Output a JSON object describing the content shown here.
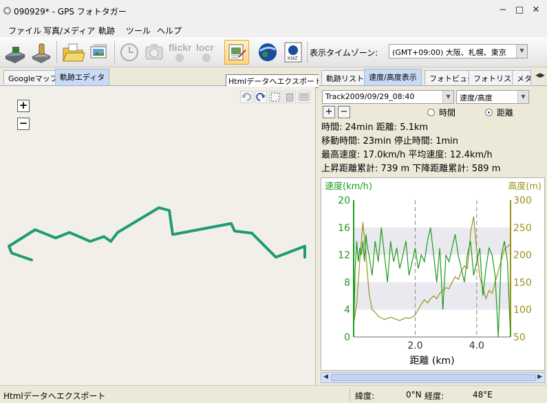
{
  "window": {
    "title": "090929* - GPS フォトタガー",
    "minimize": "−",
    "maximize": "□",
    "close": "✕"
  },
  "menu": [
    "ファイル",
    "写真/メディア",
    "軌跡",
    "ツール",
    "ヘルプ"
  ],
  "toolbar": {
    "flickr_label": "flickr",
    "locr_label": "locr",
    "kmz_label": "KMZ",
    "timezone_label": "表示タイムゾーン:",
    "timezone_value": "(GMT+09:00) 大阪、札幌、東京",
    "tooltip": "Htmlデータへエクスポート"
  },
  "left_tabs": [
    "Googleマップ",
    "軌跡エディタ"
  ],
  "map": {
    "zoom_in": "+",
    "zoom_out": "−"
  },
  "right_tabs": [
    "軌跡リスト",
    "速度/高度表示",
    "フォトビュー",
    "フォトリスト",
    "メタ"
  ],
  "controls": {
    "track": "Track2009/09/29_08:40",
    "mode": "速度/高度",
    "add": "+",
    "remove": "−",
    "radio_time": "時間",
    "radio_distance": "距離",
    "selected": "distance"
  },
  "stats": {
    "line1": "時間: 24min  距離: 5.1km",
    "line2": "移動時間: 23min  停止時間: 1min",
    "line3": "最高速度: 17.0km/h  平均速度: 12.4km/h",
    "line4": "上昇距離累計: 739 m  下降距離累計: 589 m"
  },
  "chart_data": {
    "type": "line",
    "xlabel": "距離 (km)",
    "xlim": [
      0,
      5.1
    ],
    "x_ticks": [
      "2.0",
      "4.0"
    ],
    "y_left": {
      "label": "速度(km/h)",
      "lim": [
        0,
        20
      ],
      "ticks": [
        "0",
        "4",
        "8",
        "12",
        "16",
        "20"
      ],
      "color": "#1a9a1a"
    },
    "y_right": {
      "label": "高度(m)",
      "lim": [
        50,
        300
      ],
      "ticks": [
        "50",
        "100",
        "150",
        "200",
        "250",
        "300"
      ],
      "color": "#9b9018"
    },
    "series": [
      {
        "color": "#1a9a1a",
        "x": [
          0.0,
          0.05,
          0.1,
          0.15,
          0.2,
          0.25,
          0.3,
          0.35,
          0.4,
          0.45,
          0.5,
          0.6,
          0.7,
          0.8,
          0.9,
          1.0,
          1.1,
          1.2,
          1.3,
          1.4,
          1.5,
          1.6,
          1.7,
          1.8,
          1.9,
          2.0,
          2.1,
          2.2,
          2.3,
          2.4,
          2.5,
          2.6,
          2.7,
          2.8,
          2.9,
          3.0,
          3.1,
          3.2,
          3.3,
          3.4,
          3.5,
          3.6,
          3.7,
          3.8,
          3.9,
          4.0,
          4.1,
          4.2,
          4.3,
          4.4,
          4.5,
          4.6,
          4.7,
          4.8,
          4.9,
          5.0,
          5.1
        ],
        "values": [
          0,
          10,
          14,
          11,
          13,
          12,
          14,
          11,
          15,
          13,
          12,
          9,
          14,
          11,
          16,
          12,
          8,
          14,
          11,
          13,
          10,
          12,
          14,
          9,
          11,
          13,
          10,
          12,
          11,
          14,
          16,
          12,
          8,
          13,
          4,
          12,
          11,
          13,
          15,
          12,
          10,
          8,
          12,
          14,
          9,
          11,
          13,
          6,
          10,
          13,
          12,
          9,
          0,
          12,
          14,
          11,
          0
        ]
      },
      {
        "color": "#9b9018",
        "x": [
          0.0,
          0.1,
          0.2,
          0.3,
          0.4,
          0.5,
          0.6,
          0.7,
          0.8,
          0.9,
          1.0,
          1.1,
          1.2,
          1.3,
          1.4,
          1.5,
          1.6,
          1.7,
          1.8,
          1.9,
          2.0,
          2.1,
          2.2,
          2.3,
          2.4,
          2.5,
          2.6,
          2.7,
          2.8,
          2.9,
          3.0,
          3.1,
          3.2,
          3.3,
          3.4,
          3.5,
          3.6,
          3.7,
          3.8,
          3.9,
          4.0,
          4.1,
          4.2,
          4.3,
          4.4,
          4.5,
          4.6,
          4.7,
          4.8,
          4.9,
          5.0,
          5.1
        ],
        "values": [
          75,
          110,
          190,
          260,
          200,
          130,
          100,
          95,
          88,
          85,
          82,
          84,
          86,
          84,
          82,
          80,
          83,
          85,
          84,
          86,
          90,
          100,
          110,
          118,
          112,
          120,
          125,
          120,
          130,
          135,
          140,
          138,
          150,
          160,
          155,
          170,
          180,
          175,
          240,
          270,
          210,
          160,
          140,
          120,
          135,
          130,
          150,
          170,
          190,
          210,
          215,
          220
        ]
      }
    ]
  },
  "status": {
    "message": "Htmlデータへエクスポート",
    "lat_label": "緯度:",
    "lat_value": "0°N",
    "lon_label": "経度:",
    "lon_value": "48°E"
  }
}
